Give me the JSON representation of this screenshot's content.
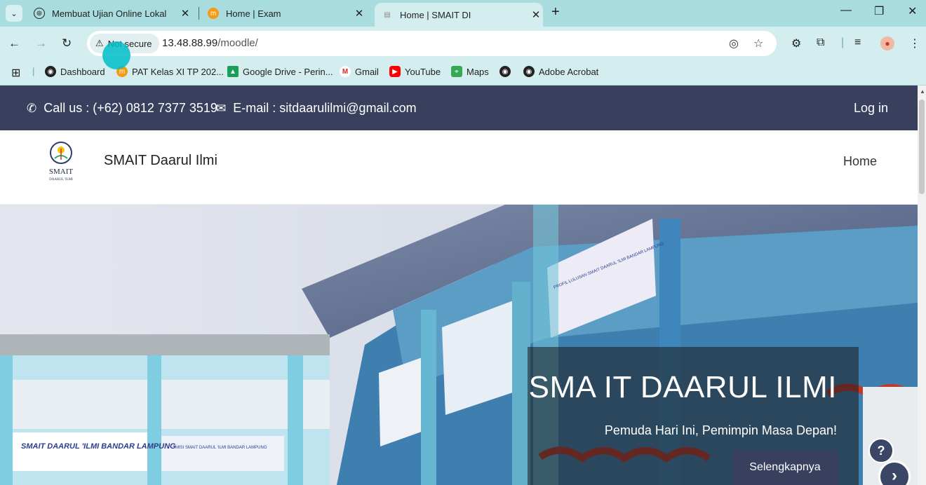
{
  "browser": {
    "tabs": [
      {
        "title": "Membuat Ujian Online Lokal",
        "favicon": "openai-icon",
        "color": "#1f1f1f"
      },
      {
        "title": "Home | Exam",
        "favicon": "moodle-icon",
        "color": "#f39c12"
      },
      {
        "title": "Home | SMAIT DI",
        "favicon": "page-icon",
        "color": "#888888",
        "active": true
      }
    ],
    "security_chip": "Not secure",
    "url_host": "13.48.88.99",
    "url_path": "/moodle/",
    "bookmarks": [
      {
        "label": "Dashboard",
        "icon": "globe-icon",
        "color": "#222222"
      },
      {
        "label": "PAT Kelas XI TP 202...",
        "icon": "moodle-icon",
        "color": "#f39c12"
      },
      {
        "label": "Google Drive - Perin...",
        "icon": "drive-icon",
        "color": "#1a9f56"
      },
      {
        "label": "Gmail",
        "icon": "gmail-icon",
        "color": "#d93025"
      },
      {
        "label": "YouTube",
        "icon": "youtube-icon",
        "color": "#ff0000"
      },
      {
        "label": "Maps",
        "icon": "maps-icon",
        "color": "#34a853"
      },
      {
        "label": "",
        "icon": "globe-icon",
        "color": "#222222"
      },
      {
        "label": "Adobe Acrobat",
        "icon": "globe-icon",
        "color": "#222222"
      }
    ]
  },
  "page": {
    "contact": {
      "phone": "Call us : (+62) 0812 7377 3519",
      "email": "E-mail : sitdaarulilmi@gmail.com"
    },
    "login_label": "Log in",
    "site_name": "SMAIT Daarul Ilmi",
    "logo_text": "SMAIT",
    "logo_subtext": "DAARUL 'ILMI",
    "nav": {
      "home": "Home"
    },
    "hero": {
      "title": "SMA IT DAARUL ILMI",
      "subtitle": "Pemuda Hari Ini, Pemimpin Masa Depan!",
      "button": "Selengkapnya",
      "banner_left": "SMAIT DAARUL 'ILMI BANDAR LAMPUNG",
      "banner_mid": "MISI SMAIT DAARUL 'ILMI BANDAR LAMPUNG",
      "banner_top": "PROFIL LULUSAN SMAIT DAARUL 'ILMI BANDAR LAMPUNG"
    },
    "help_label": "?",
    "next_label": "›"
  },
  "colors": {
    "tabstrip": "#a9dcdf",
    "toolbar": "#d4eef0",
    "topbar": "#38405e",
    "accent": "#00bec8"
  }
}
